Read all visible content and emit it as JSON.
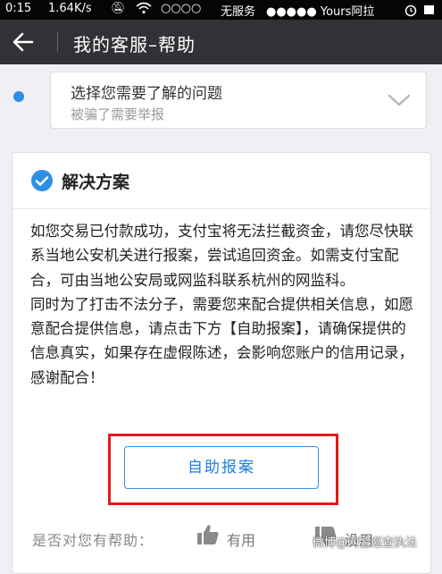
{
  "status_bar": {
    "time": "0:15",
    "speed": "1.64K/s",
    "carrier_left": "○○○○",
    "no_service": "无服务",
    "carrier_right": "●●●●● Yours阿拉"
  },
  "header": {
    "title": "我的客服–帮助"
  },
  "question": {
    "label": "选择您需要了解的问题",
    "value": "被骗了需要举报"
  },
  "solution": {
    "title": "解决方案",
    "paragraph1": "如您交易已付款成功，支付宝将无法拦截资金，请您尽快联系当地公安机关进行报案，尝试追回资金。如需支付宝配合，可由当地公安局或网监科联系杭州的网监科。",
    "paragraph2": "同时为了打击不法分子，需要您来配合提供相关信息，如愿意配合提供信息，请点击下方【自助报案】，请确保提供的信息真实，如果存在虚假陈述，会影响您账户的信用记录，感谢配合！",
    "button_label": "自助报案"
  },
  "feedback": {
    "question": "是否对您有帮助：",
    "useful": "有用",
    "useless": "没用"
  },
  "watermark": "微博@网警巡查执法",
  "colors": {
    "accent": "#2f8fe8",
    "highlight_box": "#e31a1a",
    "title_bar": "#303235",
    "background": "#efeff4"
  }
}
